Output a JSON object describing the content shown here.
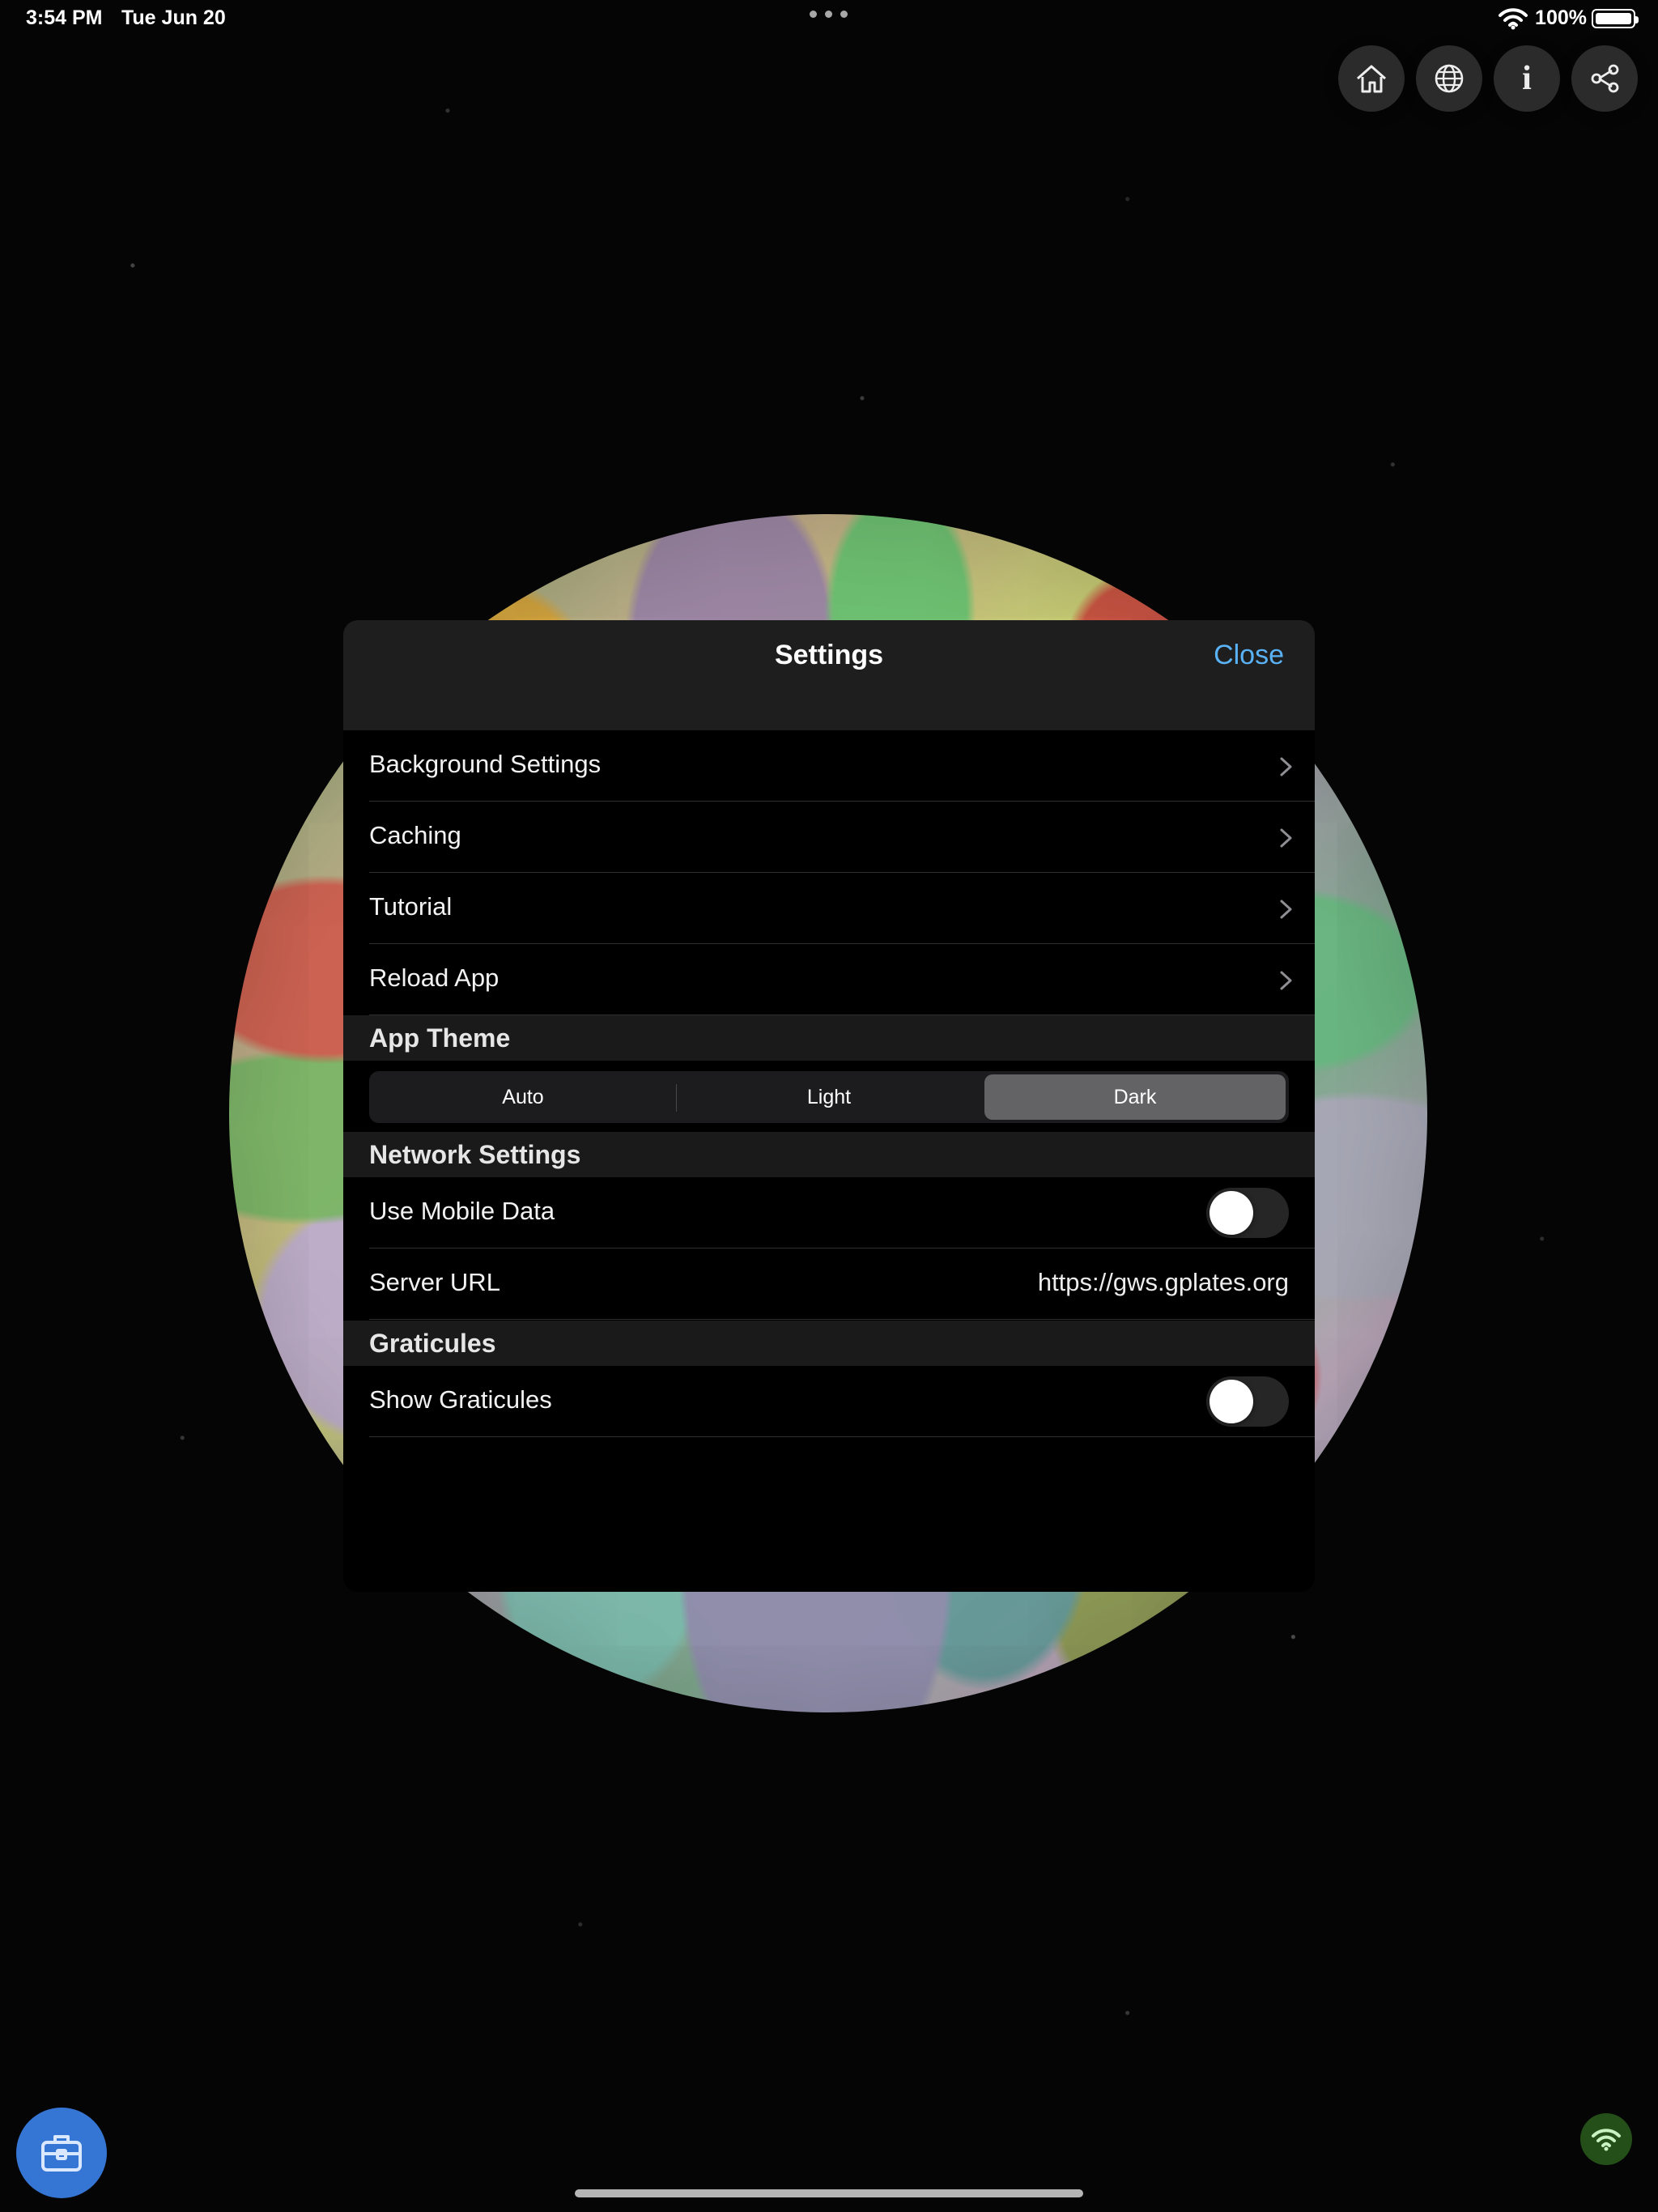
{
  "status_bar": {
    "time": "3:54 PM",
    "date": "Tue Jun 20",
    "battery": "100%"
  },
  "toolbar": {
    "buttons": [
      {
        "icon": "home-icon"
      },
      {
        "icon": "globe-icon"
      },
      {
        "icon": "info-icon",
        "label": "i"
      },
      {
        "icon": "share-icon"
      }
    ]
  },
  "settings": {
    "title": "Settings",
    "close_label": "Close",
    "items": [
      {
        "label": "Background Settings",
        "icon": "chevron-right-icon"
      },
      {
        "label": "Caching",
        "icon": "chevron-right-icon"
      },
      {
        "label": "Tutorial",
        "icon": "chevron-right-icon"
      },
      {
        "label": "Reload App",
        "icon": "chevron-right-icon"
      }
    ],
    "sections": {
      "app_theme": {
        "title": "App Theme",
        "options": [
          "Auto",
          "Light",
          "Dark"
        ],
        "selected": "Dark"
      },
      "network": {
        "title": "Network Settings",
        "mobile_data_label": "Use Mobile Data",
        "mobile_data_enabled": false,
        "server_url_label": "Server URL",
        "server_url_value": "https://gws.gplates.org"
      },
      "graticules": {
        "title": "Graticules",
        "show_label": "Show Graticules",
        "enabled": false
      }
    }
  },
  "bottom_controls": {
    "toolbox_icon": "toolbox-icon",
    "network_icon": "wifi-icon"
  },
  "colors": {
    "background": "#050505",
    "sheet_background": "#000000",
    "header_background": "#1e1e1e",
    "accent_blue": "#5ab2f6",
    "segment_selected": "#636366",
    "toolbox_blue": "#3575d3",
    "network_green": "#244f18"
  }
}
